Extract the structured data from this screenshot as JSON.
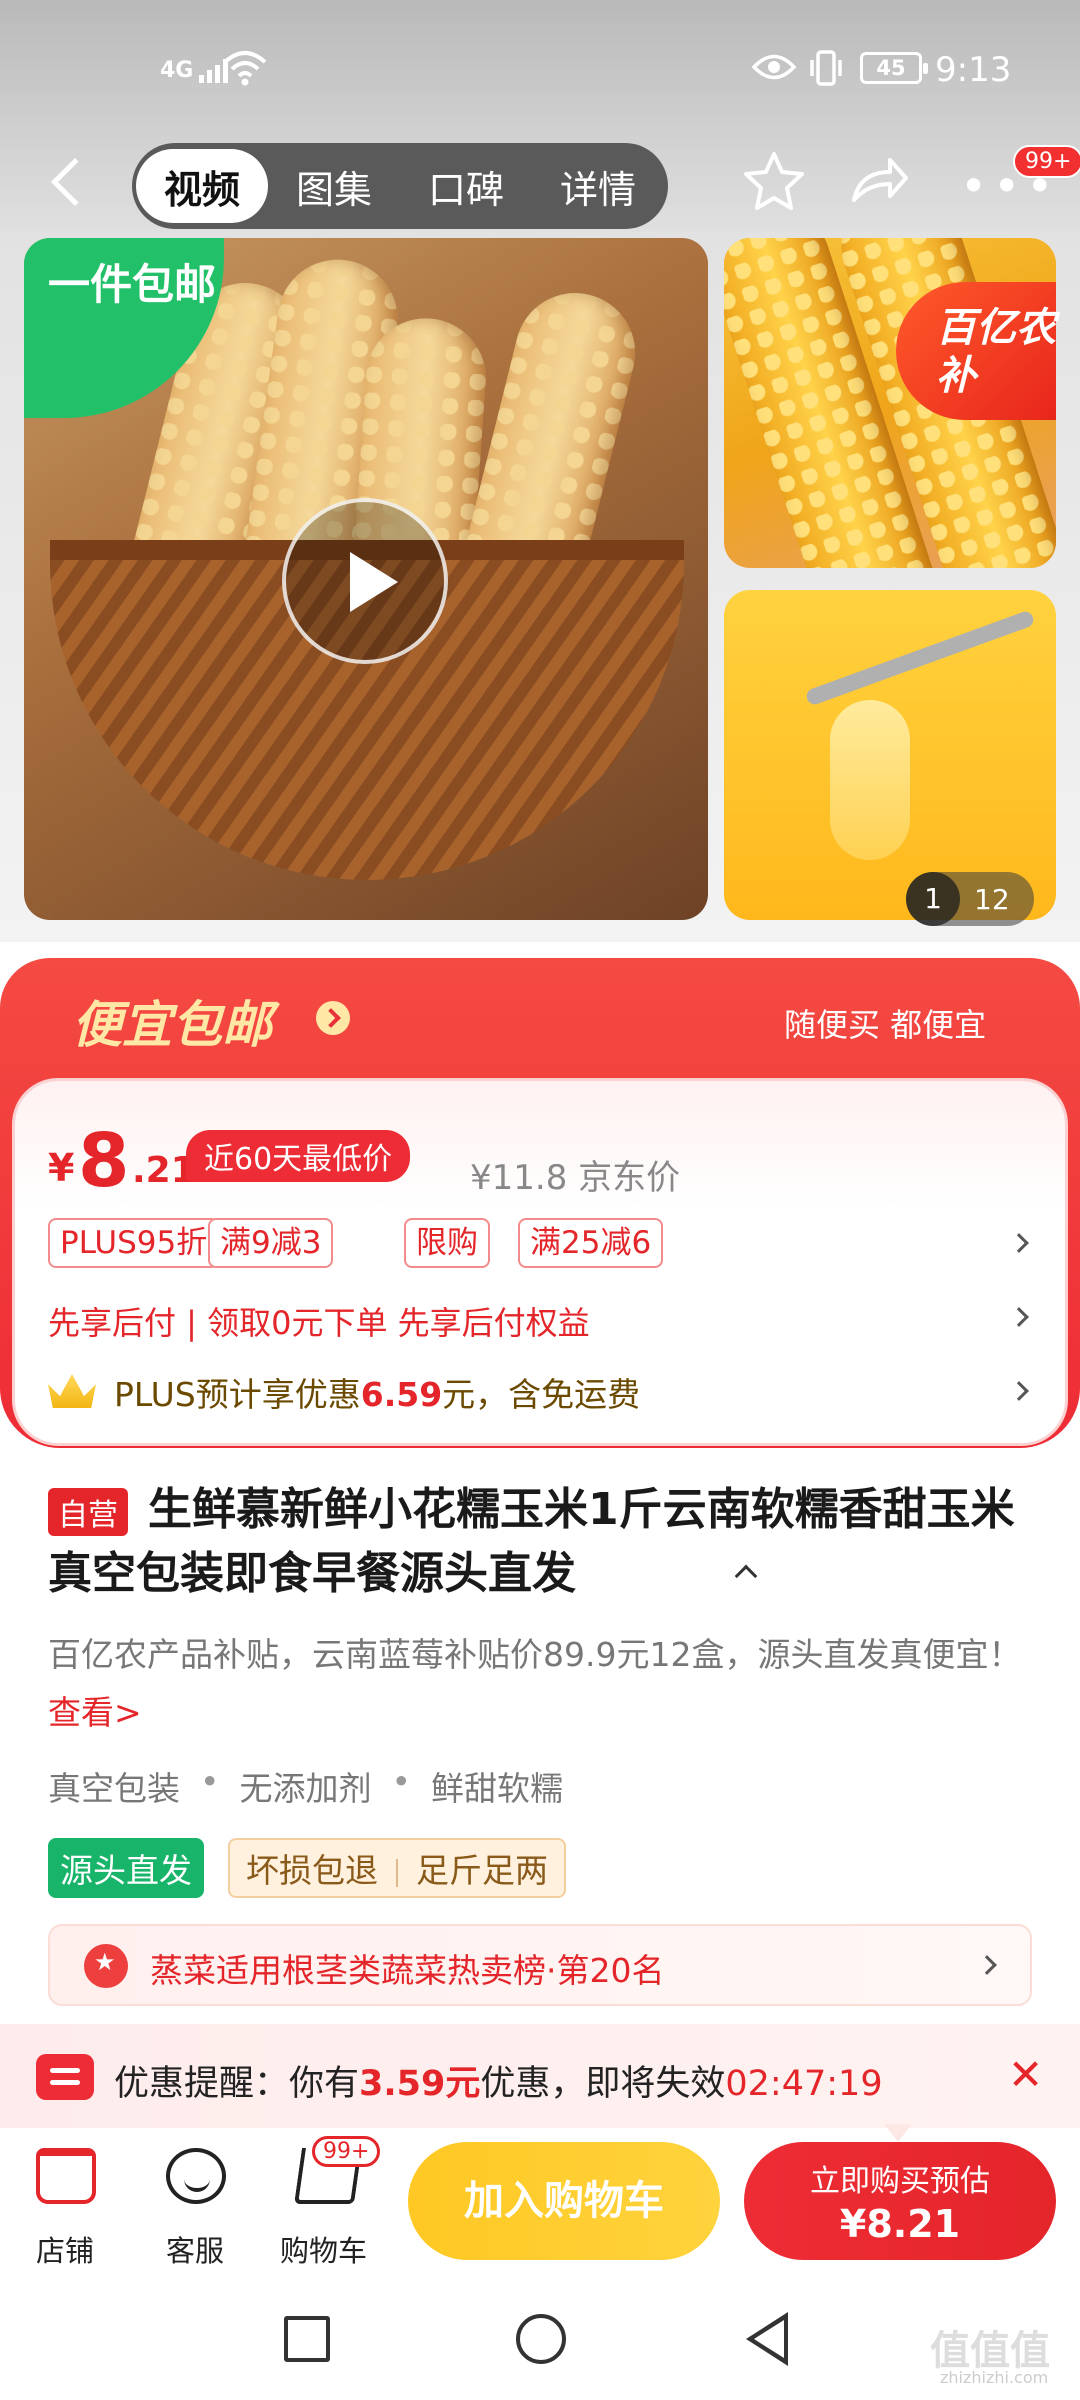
{
  "status_bar": {
    "network": "4G",
    "battery": "45",
    "time": "9:13"
  },
  "nav": {
    "tabs": [
      {
        "label": "视频"
      },
      {
        "label": "图集"
      },
      {
        "label": "口碑"
      },
      {
        "label": "详情"
      }
    ],
    "more_badge": "99+"
  },
  "gallery": {
    "ship_badge": "一件包邮",
    "subsidy_badge": "百亿农补",
    "counter_current": "1",
    "counter_total": "12"
  },
  "promo": {
    "title": "便宜包邮",
    "subtitle": "随便买 都便宜"
  },
  "price": {
    "currency": "¥",
    "integer": "8",
    "decimal": ".21",
    "low_tag": "近60天最低价",
    "original": "¥11.8 京东价",
    "chips": [
      {
        "label": "PLUS95折"
      },
      {
        "label": "满9减3"
      },
      {
        "label": "限购"
      },
      {
        "label": "满25减6"
      }
    ],
    "pay_later": "先享后付 | 领取0元下单 先享后付权益",
    "plus_prefix": "PLUS预计享优惠",
    "plus_amount": "6.59",
    "plus_suffix": "元，含免运费"
  },
  "product": {
    "self_tag": "自营",
    "title": "生鲜慕新鲜小花糯玉米1斤云南软糯香甜玉米真空包装即食早餐源头直发",
    "desc": "百亿农产品补贴，云南蓝莓补贴价89.9元12盒，源头直发真便宜！",
    "desc_link": "查看>",
    "attributes": [
      "真空包装",
      "无添加剂",
      "鲜甜软糯"
    ],
    "source_tag": "源头直发",
    "service_tags": [
      "坏损包退",
      "足斤足两"
    ],
    "rank_text": "蒸菜适用根茎类蔬菜热卖榜·第20名"
  },
  "reminder": {
    "prefix": "优惠提醒：你有",
    "amount": "3.59元",
    "middle": "优惠，即将失效",
    "countdown": "02:47:19"
  },
  "bottom_bar": {
    "shop_label": "店铺",
    "service_label": "客服",
    "cart_label": "购物车",
    "cart_badge": "99+",
    "add_cart_label": "加入购物车",
    "buy_now_label": "立即购买预估",
    "buy_now_price": "¥8.21"
  },
  "watermark": {
    "main": "值值值",
    "sub": "zhizhizhi.com"
  },
  "colors": {
    "accent_red": "#E4252A",
    "accent_yellow": "#FFC823",
    "source_green": "#17B46A"
  }
}
